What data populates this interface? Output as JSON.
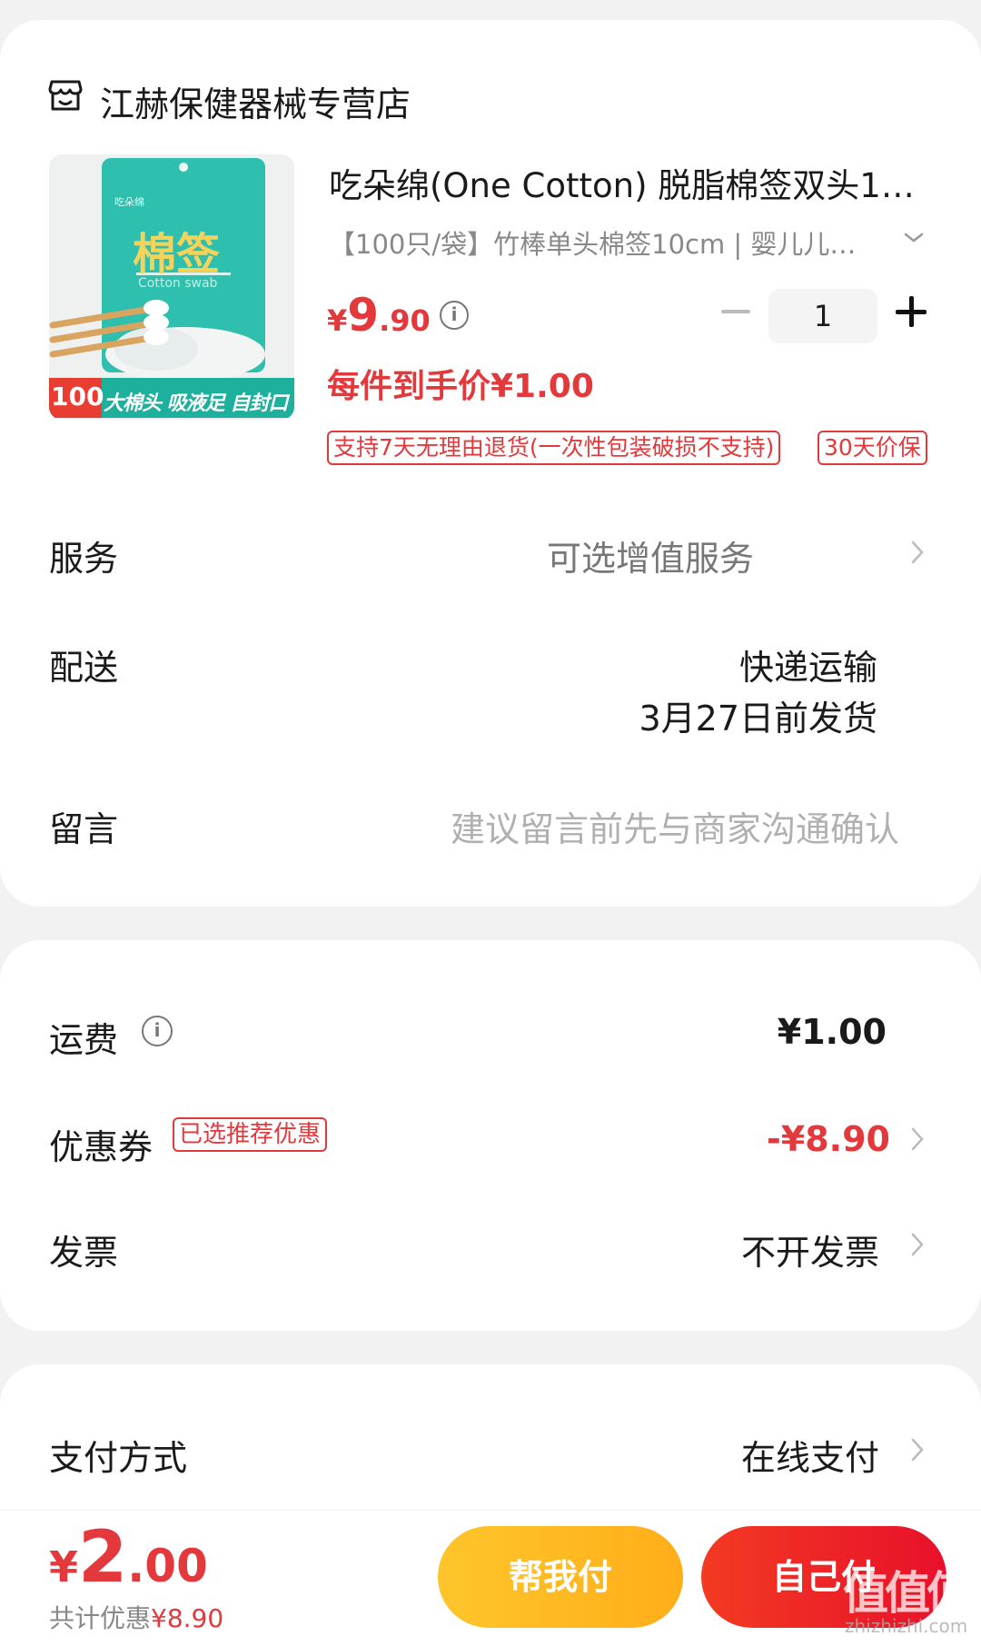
{
  "store": {
    "name": "江赫保健器械专营店",
    "icon": "store-icon"
  },
  "product": {
    "name": "吃朵绵(One Cotton) 脱脂棉签双头1…",
    "spec": "【100只/袋】竹棒单头棉签10cm | 婴儿儿…",
    "price_currency": "¥",
    "price_int": "9",
    "price_dec": ".90",
    "quantity": "1",
    "per_item_price": "每件到手价¥1.00",
    "tags": [
      "支持7天无理由退货(一次性包装破损不支持)",
      "30天价保"
    ],
    "image": {
      "brand_small": "吃朵绵",
      "title": "棉签",
      "subtitle": "Cotton swab",
      "count": "100",
      "banner": "大棉头 吸液足 自封口"
    }
  },
  "rows": {
    "service_label": "服务",
    "service_value": "可选增值服务",
    "delivery_label": "配送",
    "delivery_method": "快递运输",
    "delivery_date": "3月27日前发货",
    "message_label": "留言",
    "message_placeholder": "建议留言前先与商家沟通确认"
  },
  "fees": {
    "shipping_label": "运费",
    "shipping_value": "¥1.00",
    "coupon_label": "优惠券",
    "coupon_badge": "已选推荐优惠",
    "coupon_value": "-¥8.90",
    "invoice_label": "发票",
    "invoice_value": "不开发票"
  },
  "payment": {
    "method_label": "支付方式",
    "method_value": "在线支付"
  },
  "footer": {
    "total_currency": "¥",
    "total_int": "2",
    "total_dec": ".00",
    "saved_label": "共计优惠",
    "saved_value": "¥8.90",
    "help_pay_button": "帮我付",
    "self_pay_button": "自己付"
  },
  "watermark": {
    "text": "值值值",
    "site": "zhizhizhi.com"
  },
  "colors": {
    "accent_red": "#e4393c",
    "help_yellow": "#ffb81f",
    "self_red": "#ee2424"
  }
}
